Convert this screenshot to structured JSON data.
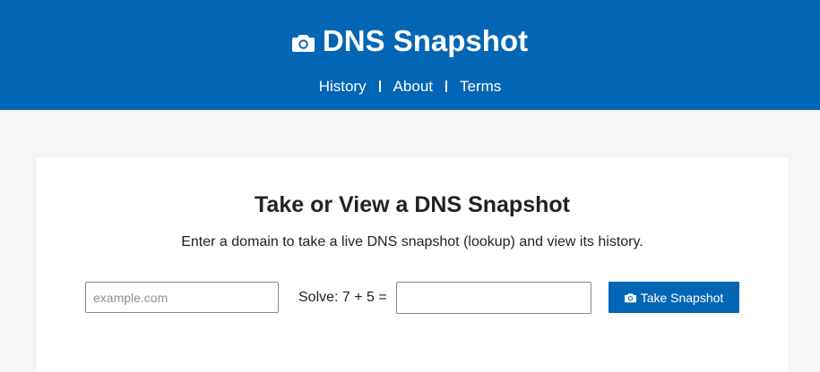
{
  "header": {
    "title": "DNS Snapshot",
    "icon": "camera-icon",
    "background": "#0366b5",
    "nav": [
      {
        "label": "History"
      },
      {
        "label": "About"
      },
      {
        "label": "Terms"
      }
    ]
  },
  "main": {
    "title": "Take or View a DNS Snapshot",
    "description": "Enter a domain to take a live DNS snapshot (lookup) and view its history.",
    "form": {
      "domain_placeholder": "example.com",
      "domain_value": "",
      "captcha_label": "Solve: 7 + 5 =",
      "captcha_value": "",
      "submit_label": "Take Snapshot",
      "submit_icon": "camera-icon"
    }
  }
}
